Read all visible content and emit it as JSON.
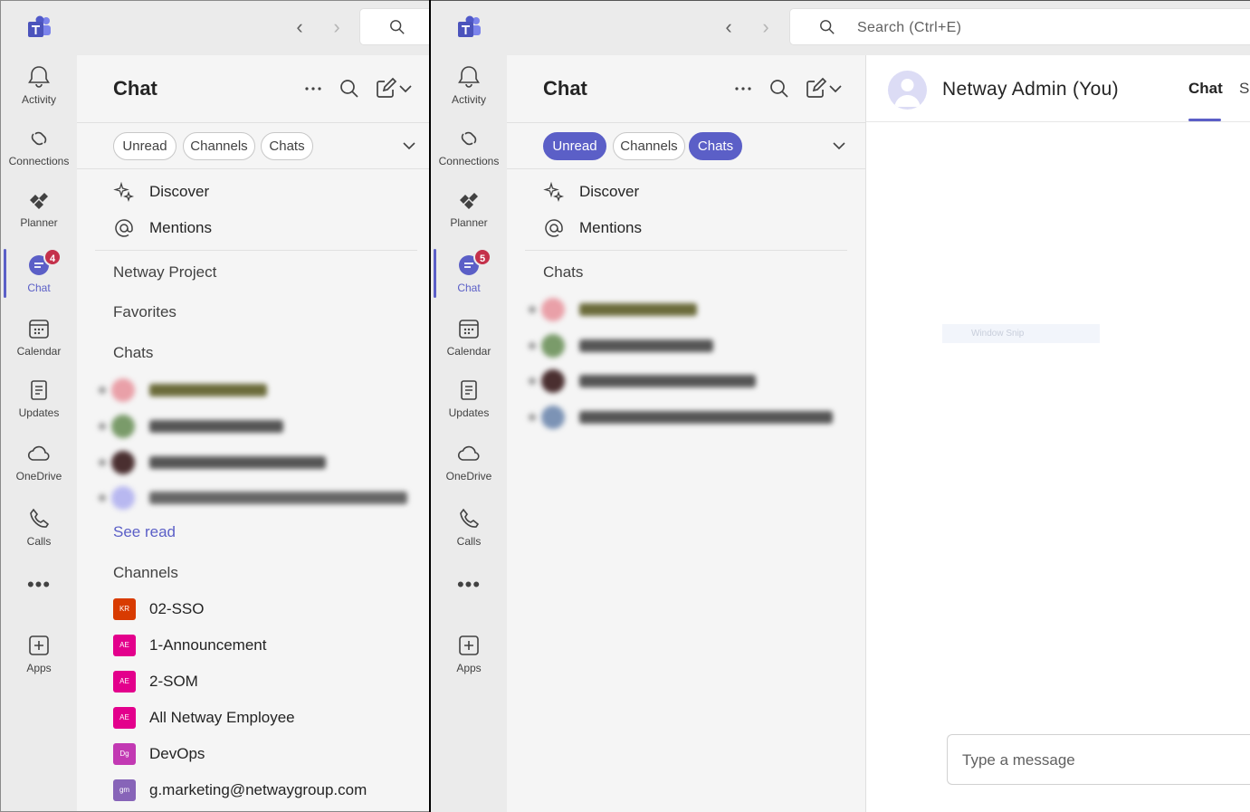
{
  "left_window": {
    "search_placeholder": "",
    "rail": {
      "activity": "Activity",
      "connections": "Connections",
      "planner": "Planner",
      "chat": "Chat",
      "chat_badge": "4",
      "calendar": "Calendar",
      "updates": "Updates",
      "onedrive": "OneDrive",
      "calls": "Calls",
      "more": "•••",
      "apps": "Apps"
    },
    "panel": {
      "title": "Chat",
      "filters": [
        "Unread",
        "Channels",
        "Chats"
      ],
      "filters_active": [
        false,
        false,
        false
      ],
      "discover": "Discover",
      "mentions": "Mentions",
      "sections": {
        "project": "Netway Project",
        "favorites": "Favorites",
        "chats": "Chats",
        "channels": "Channels"
      },
      "see_read": "See read",
      "channels": [
        {
          "initials": "KR",
          "name": "02-SSO",
          "color": "#d83b01"
        },
        {
          "initials": "AE",
          "name": "1-Announcement",
          "color": "#e3008c"
        },
        {
          "initials": "AE",
          "name": "2-SOM",
          "color": "#e3008c"
        },
        {
          "initials": "AE",
          "name": "All Netway Employee",
          "color": "#e3008c"
        },
        {
          "initials": "Dg",
          "name": "DevOps",
          "color": "#c239b3"
        },
        {
          "initials": "gm",
          "name": "g.marketing@netwaygroup.com",
          "color": "#8764b8"
        }
      ]
    }
  },
  "right_window": {
    "search_placeholder": "Search (Ctrl+E)",
    "rail": {
      "activity": "Activity",
      "connections": "Connections",
      "planner": "Planner",
      "chat": "Chat",
      "chat_badge": "5",
      "calendar": "Calendar",
      "updates": "Updates",
      "onedrive": "OneDrive",
      "calls": "Calls",
      "more": "•••",
      "apps": "Apps"
    },
    "panel": {
      "title": "Chat",
      "filters": [
        "Unread",
        "Channels",
        "Chats"
      ],
      "filters_active": [
        true,
        false,
        true
      ],
      "discover": "Discover",
      "mentions": "Mentions",
      "sections": {
        "chats": "Chats"
      }
    },
    "main": {
      "contact_name": "Netway Admin (You)",
      "tab_chat": "Chat",
      "tab_next_partial": "Sh",
      "snip_label": "Window Snip",
      "compose_placeholder": "Type a message"
    }
  },
  "colors": {
    "accent": "#5b5fc7",
    "badge": "#c4314b"
  }
}
